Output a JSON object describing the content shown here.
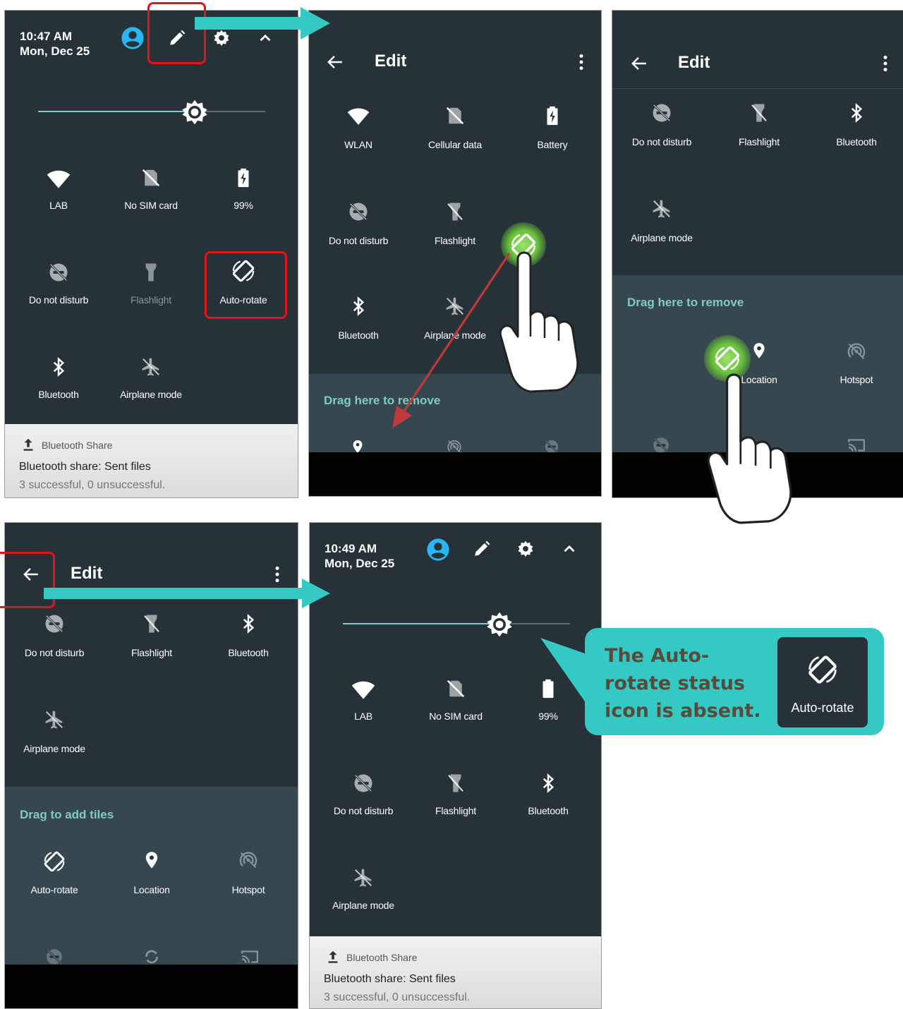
{
  "panel1": {
    "time": "10:47 AM",
    "date": "Mon, Dec 25",
    "tiles": [
      "LAB",
      "No SIM card",
      "99%",
      "Do not disturb",
      "Flashlight",
      "Auto-rotate",
      "Bluetooth",
      "Airplane mode"
    ],
    "notification": {
      "app": "Bluetooth Share",
      "title": "Bluetooth share: Sent files",
      "text": "3 successful, 0 unsuccessful."
    }
  },
  "panel2": {
    "title": "Edit",
    "tiles": [
      "WLAN",
      "Cellular data",
      "Battery",
      "Do not disturb",
      "Flashlight",
      "Bluetooth",
      "Airplane mode"
    ],
    "drag_label": "Drag here to remove"
  },
  "panel3": {
    "title": "Edit",
    "tiles": [
      "Do not disturb",
      "Flashlight",
      "Bluetooth",
      "Airplane mode"
    ],
    "drag_label": "Drag here to remove",
    "drag_tiles": [
      "Location",
      "Hotspot"
    ]
  },
  "panel4": {
    "title": "Edit",
    "tiles": [
      "Do not disturb",
      "Flashlight",
      "Bluetooth",
      "Airplane mode"
    ],
    "drag_label": "Drag to add tiles",
    "drag_tiles": [
      "Auto-rotate",
      "Location",
      "Hotspot"
    ]
  },
  "panel5": {
    "time": "10:49 AM",
    "date": "Mon, Dec 25",
    "tiles": [
      "LAB",
      "No SIM card",
      "99%",
      "Do not disturb",
      "Flashlight",
      "Bluetooth",
      "Airplane mode"
    ],
    "notification": {
      "app": "Bluetooth Share",
      "title": "Bluetooth share: Sent files",
      "text": "3 successful, 0 unsuccessful."
    }
  },
  "callout": {
    "text": "The Auto-rotate status icon is absent.",
    "tile_label": "Auto-rotate"
  },
  "colors": {
    "panel_bg": "#263238",
    "accent": "#34c9c4",
    "highlight": "#e0141b",
    "drag_label": "#80cbc4"
  }
}
